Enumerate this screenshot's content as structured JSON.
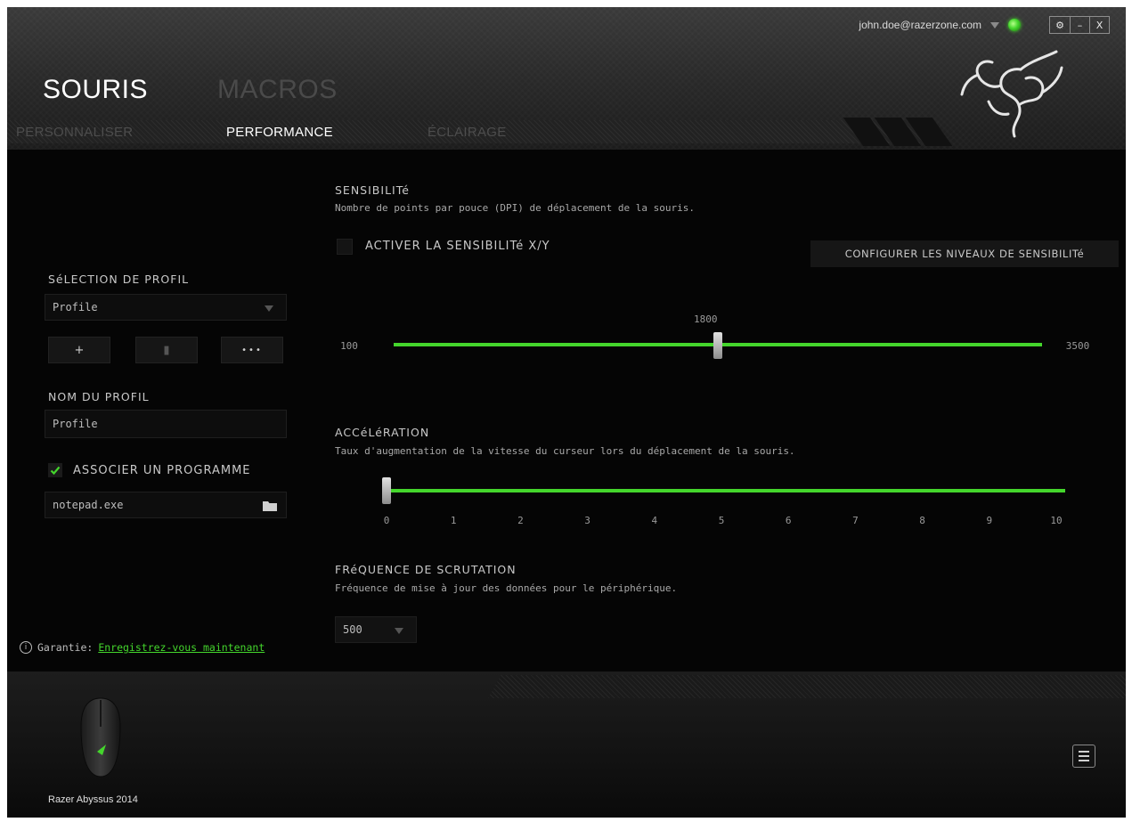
{
  "header": {
    "user_email": "john.doe@razerzone.com",
    "main_tabs": [
      "SOURIS",
      "MACROS"
    ],
    "sub_tabs": [
      "PERSONNALISER",
      "PERFORMANCE",
      "ÉCLAIRAGE"
    ],
    "window_controls": [
      "⚙",
      "–",
      "X"
    ]
  },
  "profile": {
    "section_title": "SéLECTION DE PROFIL",
    "selected_profile": "Profile",
    "buttons": {
      "add": "+",
      "delete": "▮",
      "more": "•••"
    },
    "name_label": "NOM DU PROFIL",
    "name_value": "Profile",
    "link_program_label": "ASSOCIER UN PROGRAMME",
    "link_program_checked": true,
    "program_value": "notepad.exe"
  },
  "sensitivity": {
    "title": "SENSIBILITé",
    "description": "Nombre de points par pouce (DPI) de déplacement de la souris.",
    "xy_label": "ACTIVER LA SENSIBILITé X/Y",
    "xy_checked": false,
    "configure_button": "CONFIGURER LES NIVEAUX DE SENSIBILITé",
    "min": "100",
    "max": "3500",
    "value": 1800,
    "value_label": "1800"
  },
  "acceleration": {
    "title": "ACCéLéRATION",
    "description": "Taux d'augmentation de la vitesse du curseur lors du déplacement de la souris.",
    "ticks": [
      "0",
      "1",
      "2",
      "3",
      "4",
      "5",
      "6",
      "7",
      "8",
      "9",
      "10"
    ],
    "value": 0
  },
  "polling": {
    "title": "FRéQUENCE DE SCRUTATION",
    "description": "Fréquence de mise à jour des données pour le périphérique.",
    "selected": "500"
  },
  "warranty": {
    "label": "Garantie:",
    "link": "Enregistrez-vous maintenant"
  },
  "device": {
    "name": "Razer Abyssus 2014"
  },
  "colors": {
    "accent": "#44d62c",
    "background": "#050505"
  }
}
